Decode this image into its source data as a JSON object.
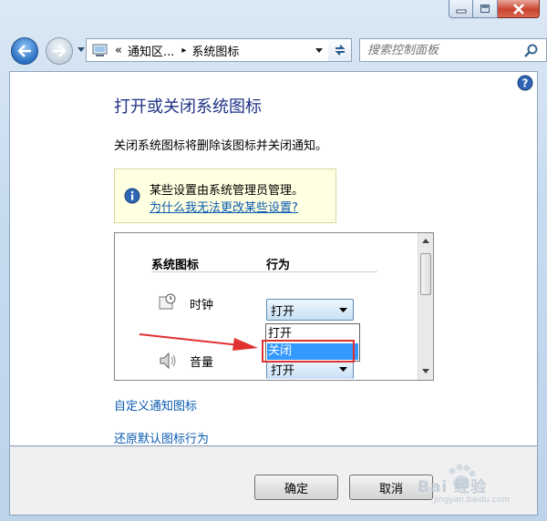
{
  "window": {
    "caption": {
      "minimize_icon": "minimize-icon",
      "maximize_icon": "maximize-icon",
      "close_icon": "close-icon"
    }
  },
  "nav": {
    "breadcrumb_root": "«",
    "breadcrumb_1": "通知区...",
    "breadcrumb_sep": "▸",
    "breadcrumb_2": "系统图标",
    "search_placeholder": "搜索控制面板"
  },
  "page": {
    "title": "打开或关闭系统图标",
    "description": "关闭系统图标将删除该图标并关闭通知。",
    "info_text": "某些设置由系统管理员管理。",
    "info_link": "为什么我无法更改某些设置?"
  },
  "table": {
    "col_icon": "系统图标",
    "col_behavior": "行为",
    "rows": [
      {
        "name": "时钟",
        "icon": "clock-icon",
        "value": "打开"
      },
      {
        "name": "音量",
        "icon": "speaker-icon",
        "value": "打开"
      }
    ]
  },
  "dropdown": {
    "options": [
      "打开",
      "关闭"
    ],
    "highlighted": "关闭"
  },
  "links": {
    "customize": "自定义通知图标",
    "restore": "还原默认图标行为"
  },
  "buttons": {
    "ok": "确定",
    "cancel": "取消"
  },
  "watermark": {
    "text": "Bai 经验",
    "subtext": "jingyan.baidu.com"
  },
  "colors": {
    "accent_blue": "#0b5bb0",
    "highlight": "#3399ff",
    "annotation_red": "#e03030"
  }
}
